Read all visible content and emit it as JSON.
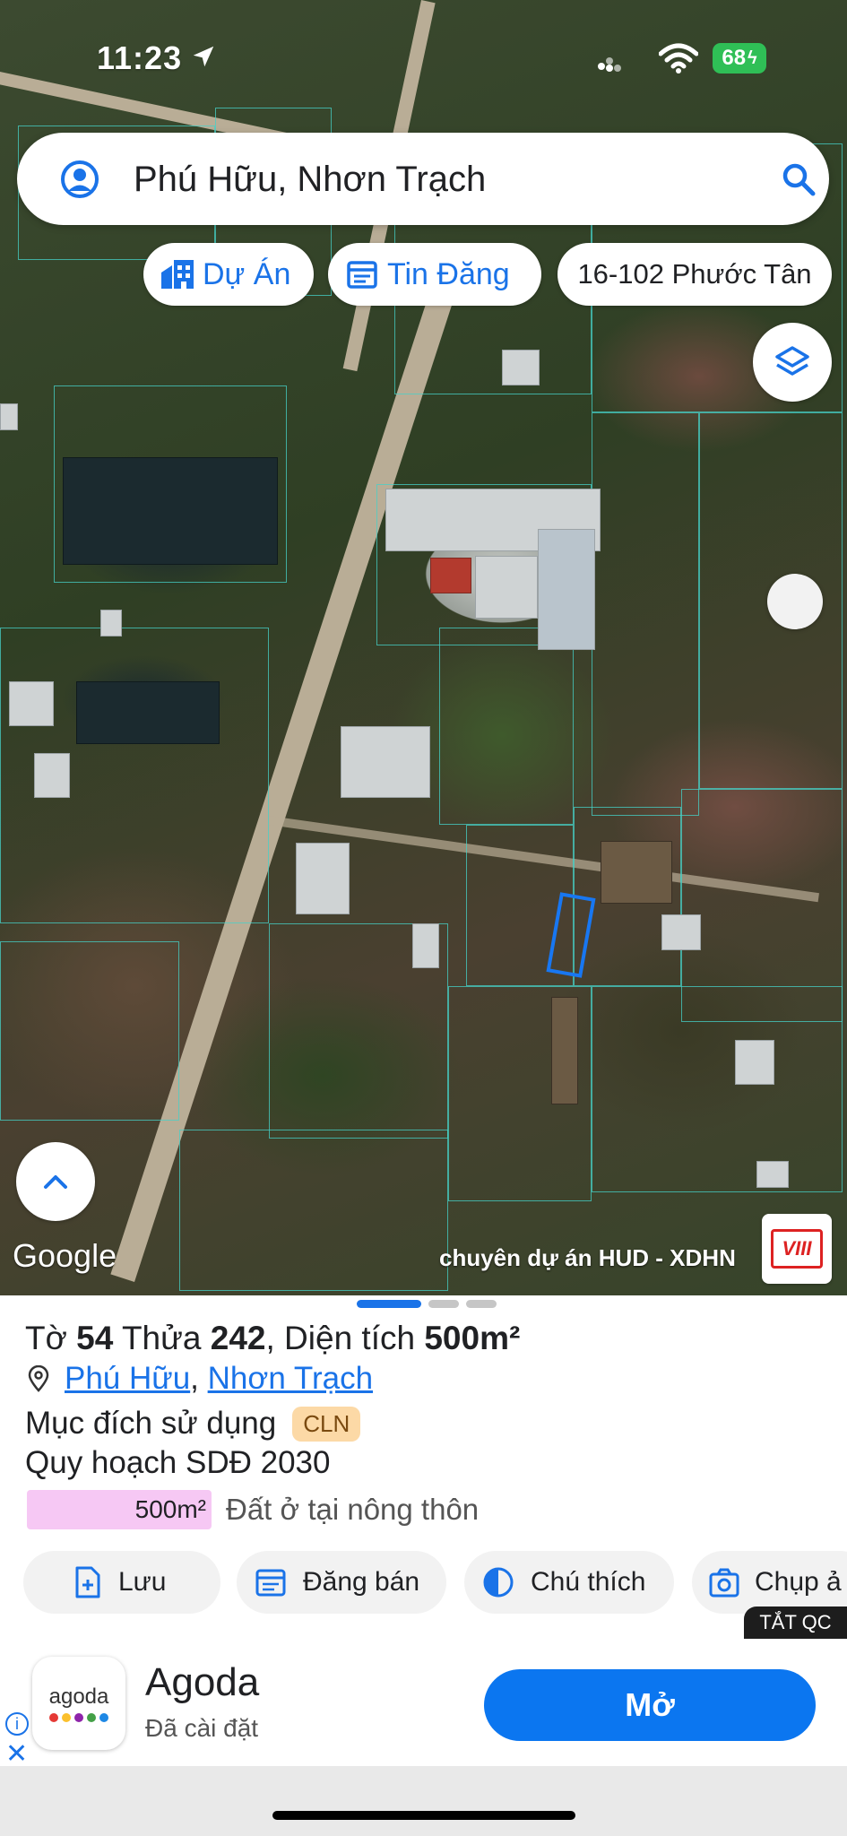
{
  "status_bar": {
    "time": "11:23",
    "battery": "68"
  },
  "search": {
    "query": "Phú Hữu, Nhơn Trạch"
  },
  "chips": [
    {
      "label": "Dự Án",
      "icon": "building-icon"
    },
    {
      "label": "Tin Đăng",
      "icon": "calendar-icon"
    },
    {
      "label": "16-102 Phước Tân"
    }
  ],
  "map": {
    "google_label": "Google",
    "attribution": "chuyên dự án HUD - XDHN",
    "logo_text": "VIII"
  },
  "parcel": {
    "to_label": "Tờ",
    "to_value": "54",
    "thua_label": "Thửa",
    "thua_value": "242",
    "area_label": "Diện tích",
    "area_value": "500m²",
    "location_ward": "Phú Hữu",
    "location_district": "Nhơn Trạch",
    "purpose_label": "Mục đích sử dụng",
    "purpose_code": "CLN",
    "plan_label": "Quy hoạch SDĐ 2030",
    "plan_area": "500m²",
    "plan_type": "Đất ở tại nông thôn",
    "plan_fraction": 1.0
  },
  "actions": [
    {
      "label": "Lưu",
      "icon": "save-add-icon"
    },
    {
      "label": "Đăng bán",
      "icon": "calendar-post-icon"
    },
    {
      "label": "Chú thích",
      "icon": "legend-icon"
    },
    {
      "label": "Chụp ả",
      "icon": "camera-icon"
    }
  ],
  "ad": {
    "tat_qc": "TẮT QC",
    "app_logo_word": "agoda",
    "app_name": "Agoda",
    "app_status": "Đã cài đặt",
    "cta": "Mở"
  },
  "colors": {
    "accent": "#1a73e8",
    "cta": "#0b76f0",
    "badge": "#fcd9a6",
    "plan_fill": "#f6c8f4"
  }
}
